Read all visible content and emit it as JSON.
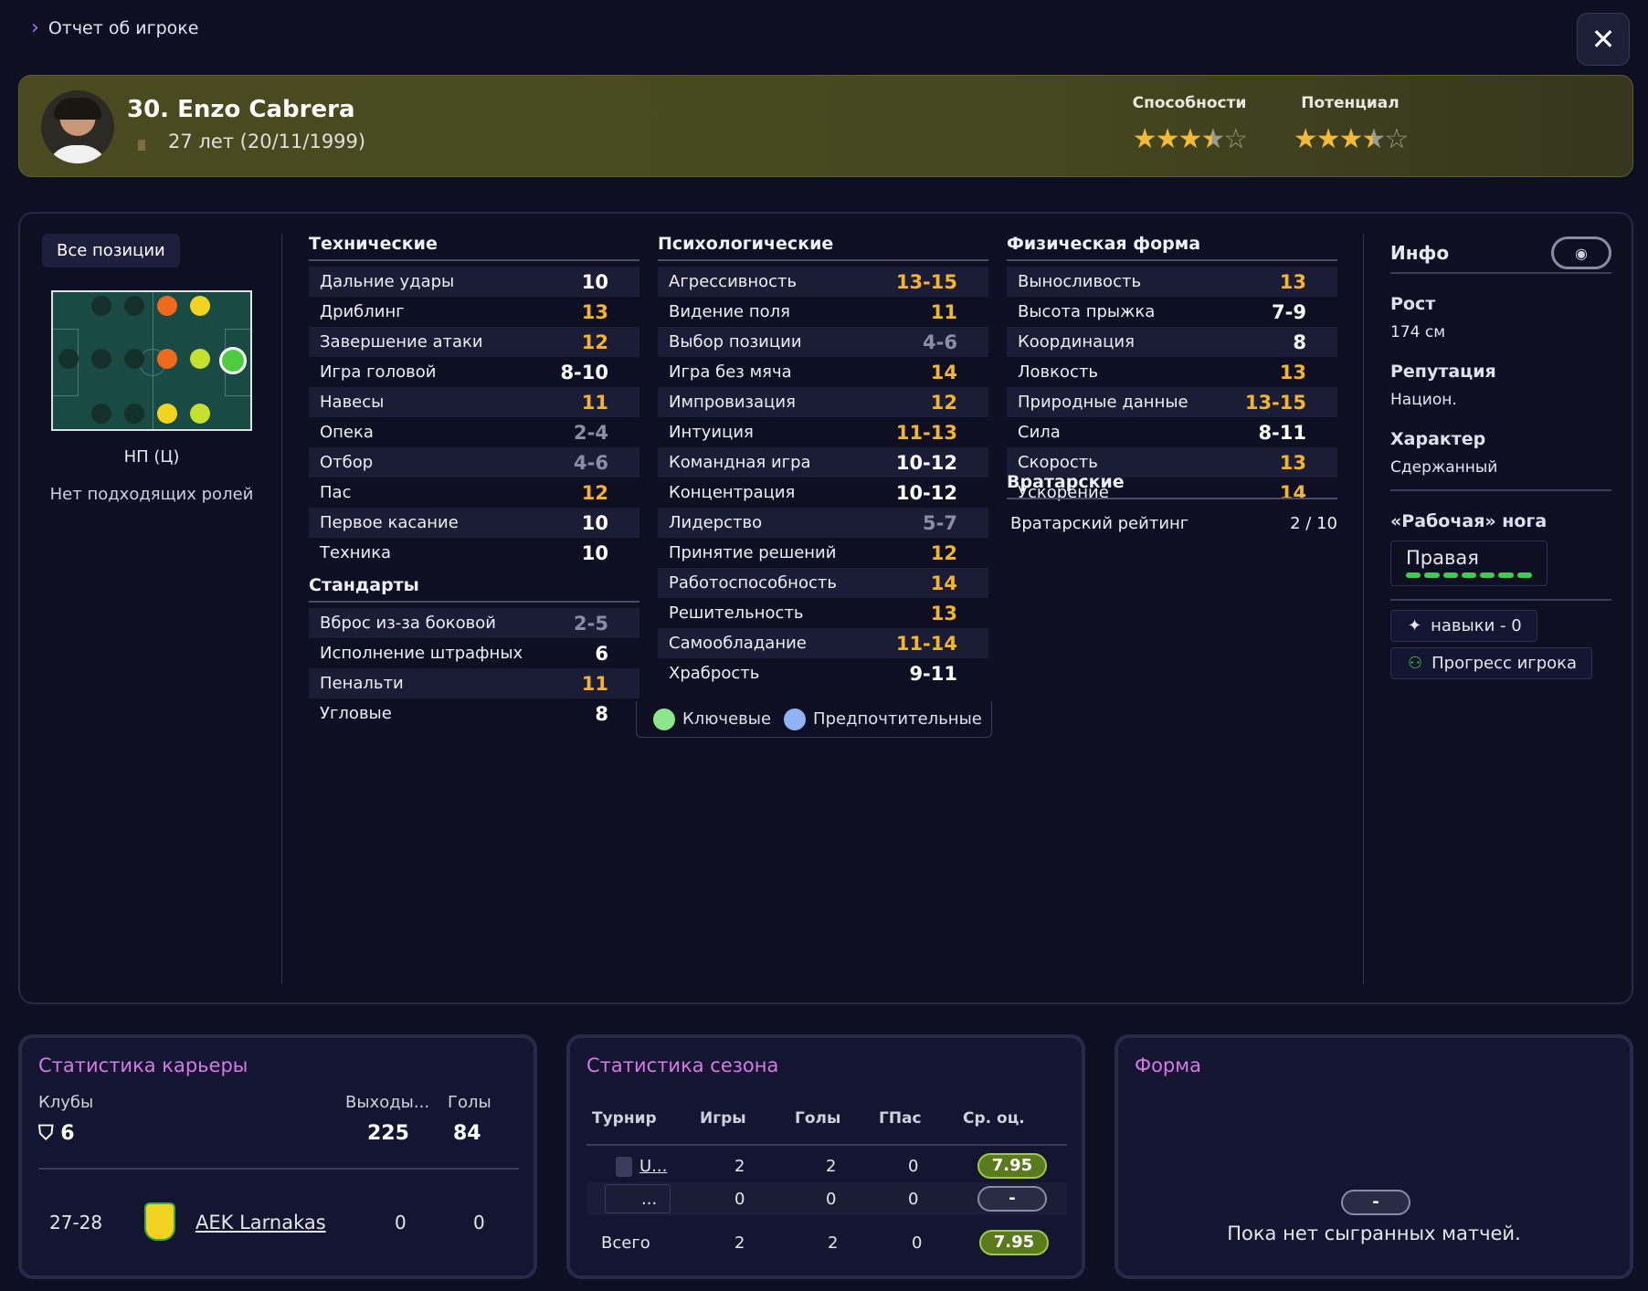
{
  "breadcrumb": "Отчет об игроке",
  "close_label": "✕",
  "player": {
    "number_name": "30. Enzo Cabrera",
    "age": "27 лет",
    "dob": "(20/11/1999)",
    "ability_label": "Способности",
    "potential_label": "Потенциал",
    "ability_stars": 3.5,
    "potential_stars": 3.5
  },
  "positions": {
    "all_positions": "Все позиции",
    "position_name": "НП (Ц)",
    "no_roles": "Нет подходящих ролей"
  },
  "technical": {
    "title": "Технические",
    "rows": [
      {
        "name": "Дальние удары",
        "value": "10",
        "tone": "w"
      },
      {
        "name": "Дриблинг",
        "value": "13",
        "tone": "o"
      },
      {
        "name": "Завершение атаки",
        "value": "12",
        "tone": "o"
      },
      {
        "name": "Игра головой",
        "value": "8-10",
        "tone": "w"
      },
      {
        "name": "Навесы",
        "value": "11",
        "tone": "o"
      },
      {
        "name": "Опека",
        "value": "2-4",
        "tone": "g"
      },
      {
        "name": "Отбор",
        "value": "4-6",
        "tone": "g"
      },
      {
        "name": "Пас",
        "value": "12",
        "tone": "o"
      },
      {
        "name": "Первое касание",
        "value": "10",
        "tone": "w"
      },
      {
        "name": "Техника",
        "value": "10",
        "tone": "w"
      }
    ]
  },
  "setpieces": {
    "title": "Стандарты",
    "rows": [
      {
        "name": "Вброс из-за боковой",
        "value": "2-5",
        "tone": "g"
      },
      {
        "name": "Исполнение штрафных",
        "value": "6",
        "tone": "w"
      },
      {
        "name": "Пенальти",
        "value": "11",
        "tone": "o"
      },
      {
        "name": "Угловые",
        "value": "8",
        "tone": "w"
      }
    ]
  },
  "mental": {
    "title": "Психологические",
    "rows": [
      {
        "name": "Агрессивность",
        "value": "13-15",
        "tone": "o"
      },
      {
        "name": "Видение поля",
        "value": "11",
        "tone": "o"
      },
      {
        "name": "Выбор позиции",
        "value": "4-6",
        "tone": "g"
      },
      {
        "name": "Игра без мяча",
        "value": "14",
        "tone": "o"
      },
      {
        "name": "Импровизация",
        "value": "12",
        "tone": "o"
      },
      {
        "name": "Интуиция",
        "value": "11-13",
        "tone": "o"
      },
      {
        "name": "Командная игра",
        "value": "10-12",
        "tone": "w"
      },
      {
        "name": "Концентрация",
        "value": "10-12",
        "tone": "w"
      },
      {
        "name": "Лидерство",
        "value": "5-7",
        "tone": "g"
      },
      {
        "name": "Принятие решений",
        "value": "12",
        "tone": "o"
      },
      {
        "name": "Работоспособность",
        "value": "14",
        "tone": "o"
      },
      {
        "name": "Решительность",
        "value": "13",
        "tone": "o"
      },
      {
        "name": "Самообладание",
        "value": "11-14",
        "tone": "o"
      },
      {
        "name": "Храбрость",
        "value": "9-11",
        "tone": "w"
      }
    ]
  },
  "physical": {
    "title": "Физическая форма",
    "rows": [
      {
        "name": "Выносливость",
        "value": "13",
        "tone": "o"
      },
      {
        "name": "Высота прыжка",
        "value": "7-9",
        "tone": "w"
      },
      {
        "name": "Координация",
        "value": "8",
        "tone": "w"
      },
      {
        "name": "Ловкость",
        "value": "13",
        "tone": "o"
      },
      {
        "name": "Природные данные",
        "value": "13-15",
        "tone": "o"
      },
      {
        "name": "Сила",
        "value": "8-11",
        "tone": "w"
      },
      {
        "name": "Скорость",
        "value": "13",
        "tone": "o"
      },
      {
        "name": "Ускорение",
        "value": "14",
        "tone": "o"
      }
    ]
  },
  "goalkeeping": {
    "title": "Вратарские",
    "rating_label": "Вратарский рейтинг",
    "rating_value": "2 / 10"
  },
  "legend": {
    "key": "Ключевые",
    "preferred": "Предпочтительные",
    "key_color": "#8ee68a",
    "preferred_color": "#8fb4f5"
  },
  "info": {
    "title": "Инфо",
    "height_label": "Рост",
    "height_value": "174 см",
    "reputation_label": "Репутация",
    "reputation_value": "Национ.",
    "character_label": "Характер",
    "character_value": "Сдержанный",
    "foot_label": "«Рабочая» нога",
    "foot_value": "Правая",
    "skills_label": "навыки - 0",
    "progress_label": "Прогресс игрока"
  },
  "career": {
    "title": "Статистика карьеры",
    "clubs_label": "Клубы",
    "clubs_value": "6",
    "apps_label": "Выходы...",
    "apps_value": "225",
    "goals_label": "Голы",
    "goals_value": "84",
    "row": {
      "season": "27-28",
      "club": "AEK Larnakas",
      "apps": "0",
      "goals": "0"
    }
  },
  "season": {
    "title": "Статистика сезона",
    "headers": [
      "Турнир",
      "Игры",
      "Голы",
      "ГПас",
      "Ср. оц."
    ],
    "rows": [
      {
        "tournament": "U...",
        "games": "2",
        "goals": "2",
        "assists": "0",
        "rating": "7.95"
      },
      {
        "tournament": "...",
        "games": "0",
        "goals": "0",
        "assists": "0",
        "rating": "-"
      }
    ],
    "total": {
      "label": "Всего",
      "games": "2",
      "goals": "2",
      "assists": "0",
      "rating": "7.95"
    }
  },
  "form": {
    "title": "Форма",
    "badge": "-",
    "empty": "Пока нет сыгранных матчей."
  },
  "colors": {
    "accent": "#a27cff",
    "card_title": "#d878e8",
    "orange_value": "#f5b429",
    "header_bg": "#4a4a20"
  }
}
